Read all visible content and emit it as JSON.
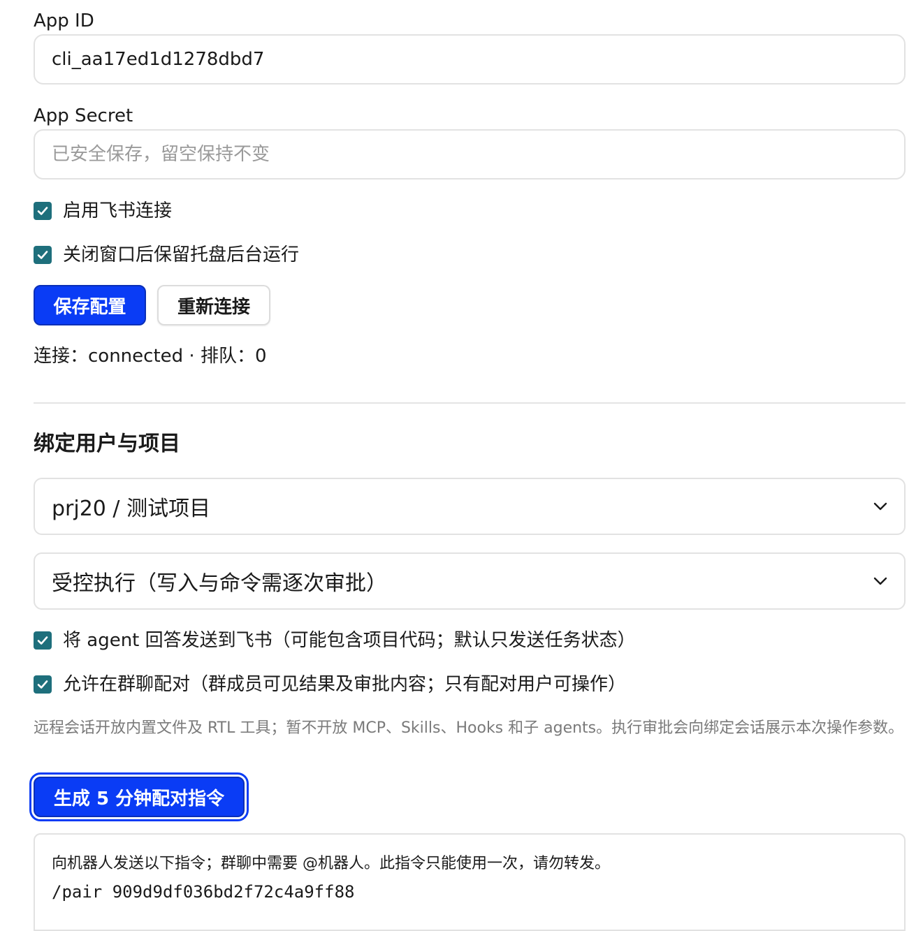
{
  "colors": {
    "accent": "#0a3cf5",
    "checkbox": "#1e6f7c",
    "border": "#e2e2e2",
    "hint_text": "#7a7a7a"
  },
  "app_id": {
    "label": "App ID",
    "value": "cli_aa17ed1d1278dbd7"
  },
  "app_secret": {
    "label": "App Secret",
    "value": "",
    "placeholder": "已安全保存，留空保持不变"
  },
  "options": {
    "enable_feishu": {
      "label": "启用飞书连接",
      "checked": true
    },
    "keep_tray": {
      "label": "关闭窗口后保留托盘后台运行",
      "checked": true
    }
  },
  "actions": {
    "save_label": "保存配置",
    "reconnect_label": "重新连接"
  },
  "status": {
    "text": "连接：connected · 排队：0"
  },
  "binding": {
    "title": "绑定用户与项目",
    "project_select": "prj20 / 测试项目",
    "mode_select": "受控执行（写入与命令需逐次审批）",
    "send_answers": {
      "label": "将 agent 回答发送到飞书（可能包含项目代码；默认只发送任务状态）",
      "checked": true
    },
    "allow_group": {
      "label": "允许在群聊配对（群成员可见结果及审批内容；只有配对用户可操作）",
      "checked": true
    },
    "hint": "远程会话开放内置文件及 RTL 工具；暂不开放 MCP、Skills、Hooks 和子 agents。执行审批会向绑定会话展示本次操作参数。",
    "generate_label": "生成 5 分钟配对指令",
    "pair_note": "向机器人发送以下指令；群聊中需要 @机器人。此指令只能使用一次，请勿转发。",
    "pair_command": "/pair 909d9df036bd2f72c4a9ff88"
  },
  "icons": {
    "checkbox_check": "check-icon",
    "select_arrow": "chevron-down-icon"
  }
}
